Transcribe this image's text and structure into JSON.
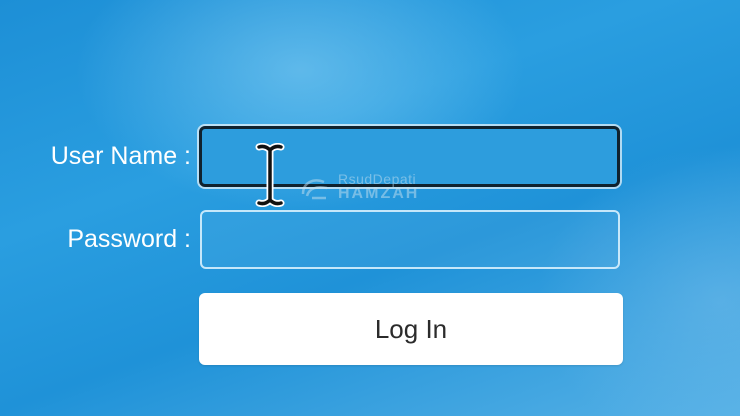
{
  "login_form": {
    "username_label": "User Name :",
    "username_value": "",
    "password_label": "Password :",
    "password_value": "",
    "login_button_label": "Log In"
  },
  "watermark": {
    "line1": "RsudDepati",
    "line2": "HAMZAH"
  },
  "colors": {
    "background": "#1f92d8",
    "button_bg": "#ffffff",
    "button_text": "#2b2b2b",
    "focused_border": "#10222e",
    "label_text": "#ffffff"
  },
  "icons": {
    "cursor": "text-cursor-icon",
    "watermark_logo": "rsud-logo-icon"
  }
}
